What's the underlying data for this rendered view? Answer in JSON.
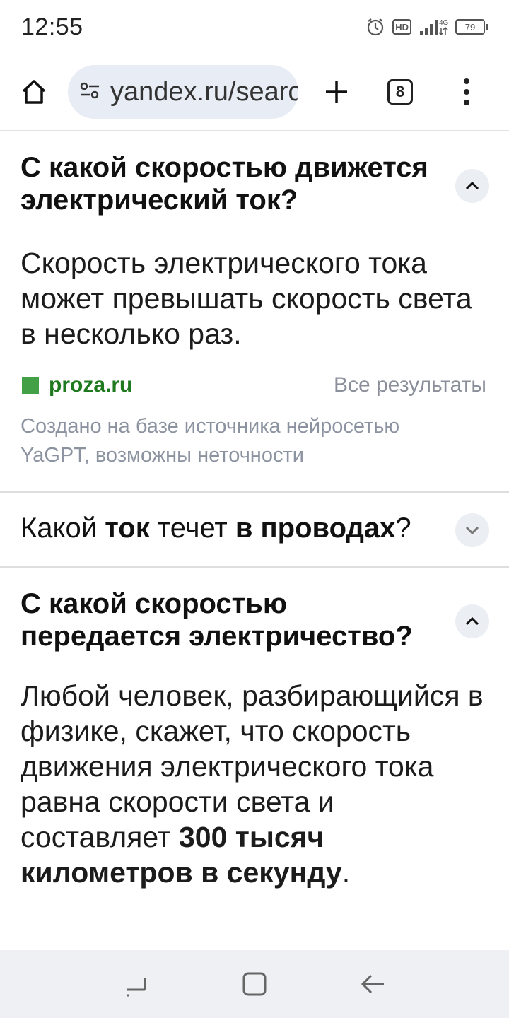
{
  "status": {
    "time": "12:55",
    "battery": "79",
    "network": "4G",
    "hd_label": "HD"
  },
  "browser": {
    "url": "yandex.ru/search",
    "tab_count": "8"
  },
  "faq": [
    {
      "question": "С какой скоростью движется электрический ток?",
      "answer": "Скорость электрического тока может превышать скорость света в несколько раз.",
      "source": "proza.ru",
      "all_results": "Все результаты",
      "disclaimer": "Создано на базе источника нейросетью YaGPT, возможны неточности"
    },
    {
      "q_part1": "Какой ",
      "q_bold1": "ток",
      "q_part2": " течет ",
      "q_bold2": "в проводах",
      "q_part3": "?"
    },
    {
      "question": "С какой скоростью передается электричество?",
      "answer_text": "Любой человек, разбирающийся в физике, скажет, что скорость движения электрического тока равна скорости света и составляет ",
      "answer_bold": "300 тысяч километров в секунду",
      "answer_end": "."
    }
  ],
  "colors": {
    "accent_green": "#1f7a1f",
    "favicon_green": "#43a047",
    "muted": "#8a8f99",
    "nav_bg": "#eef0f4"
  },
  "icons": [
    "alarm-icon",
    "hd-icon",
    "signal-icon",
    "battery-icon",
    "home-icon",
    "site-settings-icon",
    "plus-icon",
    "tabs-icon",
    "more-icon",
    "chevron-up-icon",
    "chevron-down-icon",
    "recents-icon",
    "home-square-icon",
    "back-arrow-icon"
  ]
}
